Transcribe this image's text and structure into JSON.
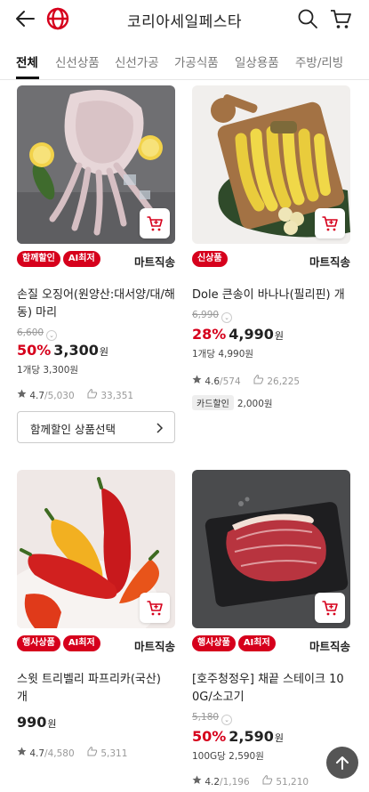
{
  "header": {
    "title": "코리아세일페스타"
  },
  "tabs": [
    {
      "label": "전체",
      "active": true
    },
    {
      "label": "신선상품",
      "active": false
    },
    {
      "label": "신선가공",
      "active": false
    },
    {
      "label": "가공식품",
      "active": false
    },
    {
      "label": "일상용품",
      "active": false
    },
    {
      "label": "주방/리빙",
      "active": false
    }
  ],
  "products": [
    {
      "badges": [
        "함께할인",
        "AI최저"
      ],
      "shipping": "마트직송",
      "name": "손질 오징어(원양산:대서양/대/해동) 마리",
      "original_price": "6,600",
      "discount": "50%",
      "price": "3,300",
      "won": "원",
      "unit_price": "1개당 3,300원",
      "rating": "4.7",
      "reviews": "/5,030",
      "wishes": "33,351",
      "option_button": "함께할인 상품선택"
    },
    {
      "badges": [
        "신상품"
      ],
      "shipping": "마트직송",
      "name": "Dole 큰송이 바나나(필리핀) 개",
      "original_price": "6,990",
      "discount": "28%",
      "price": "4,990",
      "won": "원",
      "unit_price": "1개당 4,990원",
      "rating": "4.6",
      "reviews": "/574",
      "wishes": "26,225",
      "card_label": "카드할인",
      "card_amount": "2,000원"
    },
    {
      "badges": [
        "행사상품",
        "AI최저"
      ],
      "shipping": "마트직송",
      "name": "스윗 트리벨리 파프리카(국산) 개",
      "price": "990",
      "won": "원",
      "rating": "4.7",
      "reviews": "/4,580",
      "wishes": "5,311"
    },
    {
      "badges": [
        "행사상품",
        "AI최저"
      ],
      "shipping": "마트직송",
      "name": "[호주청정우] 채끝 스테이크 100G/소고기",
      "original_price": "5,180",
      "discount": "50%",
      "price": "2,590",
      "won": "원",
      "unit_price": "100G당 2,590원",
      "rating": "4.2",
      "reviews": "/1,196",
      "wishes": "51,210"
    }
  ],
  "icons": {
    "back": "arrow-left-icon",
    "logo": "lotte-logo-icon",
    "search": "search-icon",
    "cart": "cart-icon",
    "card_cart": "add-to-cart-icon",
    "star": "star-icon",
    "wish": "wish-hand-icon",
    "chevron": "chevron-right-icon",
    "top": "scroll-top-icon"
  },
  "colors": {
    "accent": "#d6001c",
    "text": "#222222",
    "muted": "#999999"
  }
}
